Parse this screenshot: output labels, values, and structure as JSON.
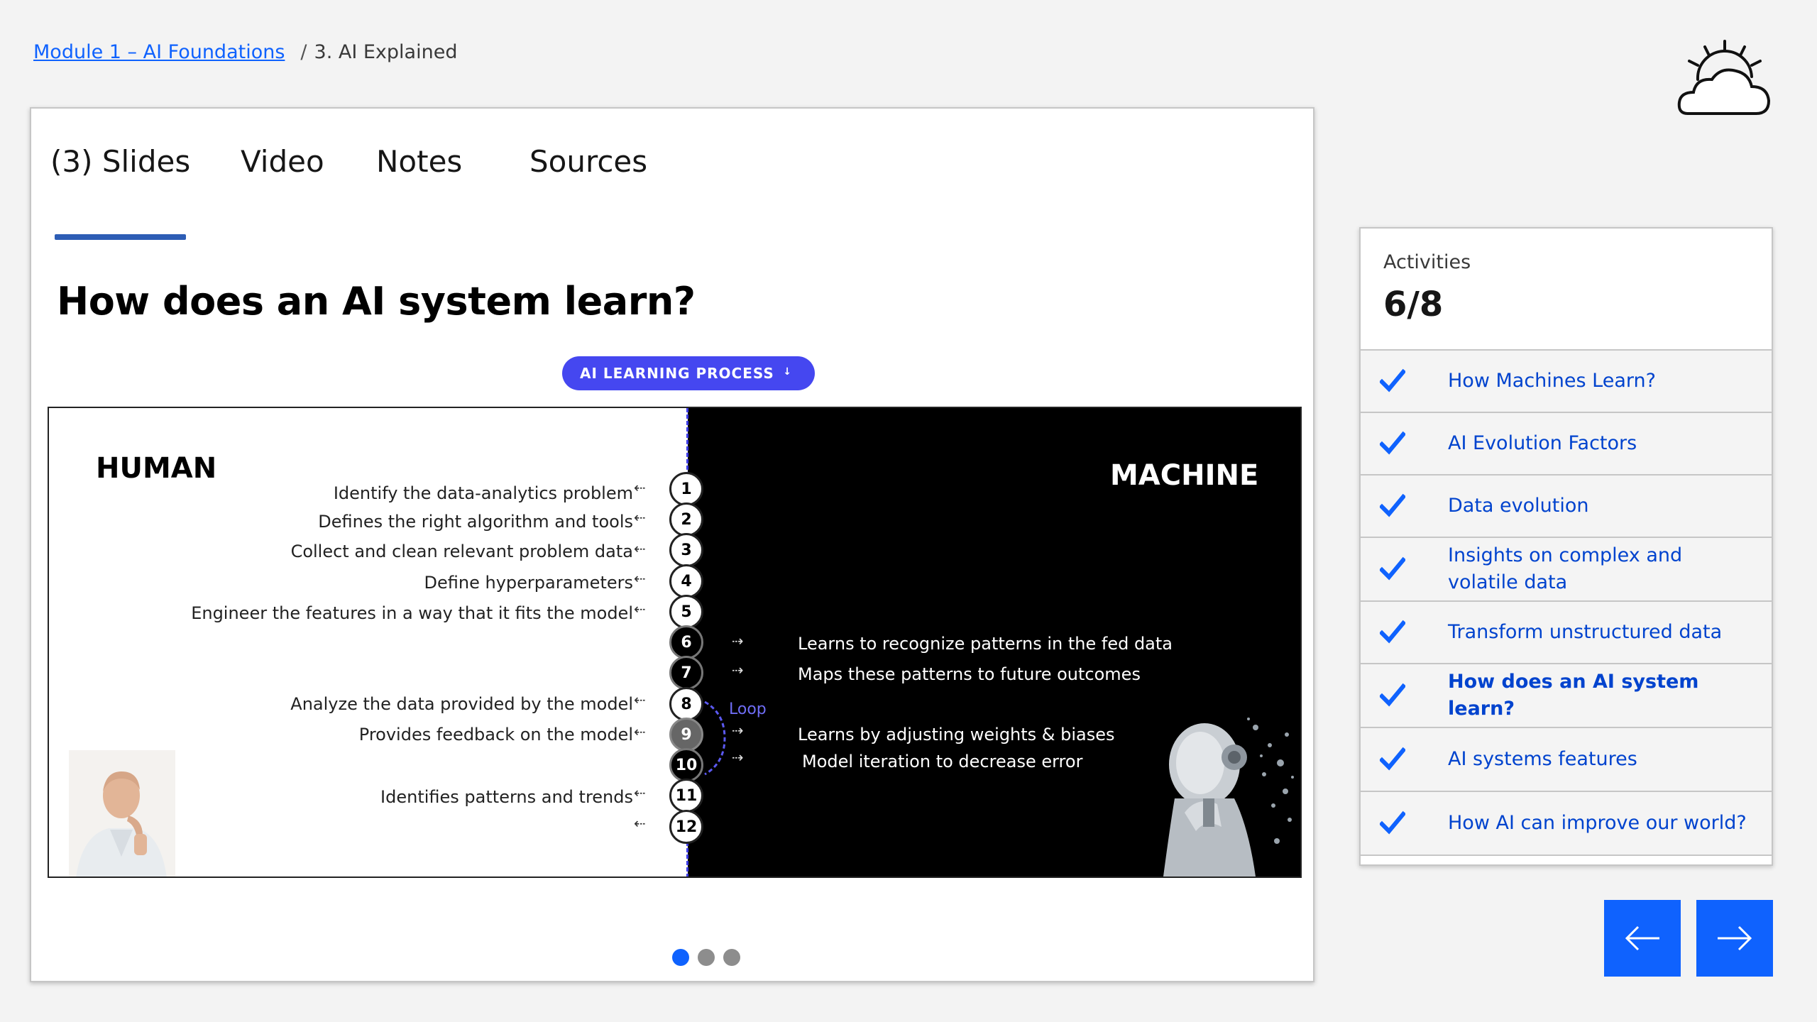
{
  "breadcrumb": {
    "module_link": "Module 1 – AI Foundations",
    "separator": "/",
    "current": "3. AI Explained"
  },
  "logo": {
    "icon": "sun-cloud-icon"
  },
  "tabs": [
    {
      "label": "(3) Slides",
      "active": true
    },
    {
      "label": "Video",
      "active": false
    },
    {
      "label": "Notes",
      "active": false
    },
    {
      "label": "Sources",
      "active": false
    }
  ],
  "slide": {
    "title": "How does an AI system learn?",
    "process_label": "AI LEARNING PROCESS",
    "process_tick": "↓",
    "human_title": "HUMAN",
    "machine_title": "MACHINE",
    "loop_label": "Loop",
    "human_steps": [
      "Identify the data-analytics problem",
      "Defines the right algorithm and tools",
      "Collect and clean relevant problem data",
      "Define hyperparameters",
      "Engineer the features in a way that it fits the model",
      "Analyze the data provided by the model",
      "Provides feedback on the model",
      "Identifies patterns and trends"
    ],
    "machine_steps": [
      "Learns to recognize patterns in the fed data",
      "Maps these patterns to future outcomes",
      "Learns by adjusting weights & biases",
      "Model iteration to decrease error"
    ],
    "step_numbers": [
      "1",
      "2",
      "3",
      "4",
      "5",
      "6",
      "7",
      "8",
      "9",
      "10",
      "11",
      "12"
    ],
    "arrow_left": "⇠",
    "arrow_right": "⇢"
  },
  "pagination": {
    "total": 3,
    "active_index": 0
  },
  "activities": {
    "label": "Activities",
    "count": "6/8",
    "items": [
      {
        "label": "How Machines Learn?",
        "done": true
      },
      {
        "label": "AI Evolution Factors",
        "done": true
      },
      {
        "label": "Data evolution",
        "done": true
      },
      {
        "label": "Insights on complex and volatile data",
        "done": true
      },
      {
        "label": "Transform unstructured data",
        "done": true
      },
      {
        "label": "How does an AI system learn?",
        "done": true,
        "current": true
      },
      {
        "label": "AI systems features",
        "done": true
      },
      {
        "label": "How AI can improve our world?",
        "done": true
      }
    ]
  },
  "nav": {
    "prev_icon": "arrow-left-icon",
    "next_icon": "arrow-right-icon"
  },
  "colors": {
    "accent": "#0f62fe",
    "tab_indicator": "#2d5db5",
    "pill": "#4547f0",
    "link": "#0043ce"
  }
}
